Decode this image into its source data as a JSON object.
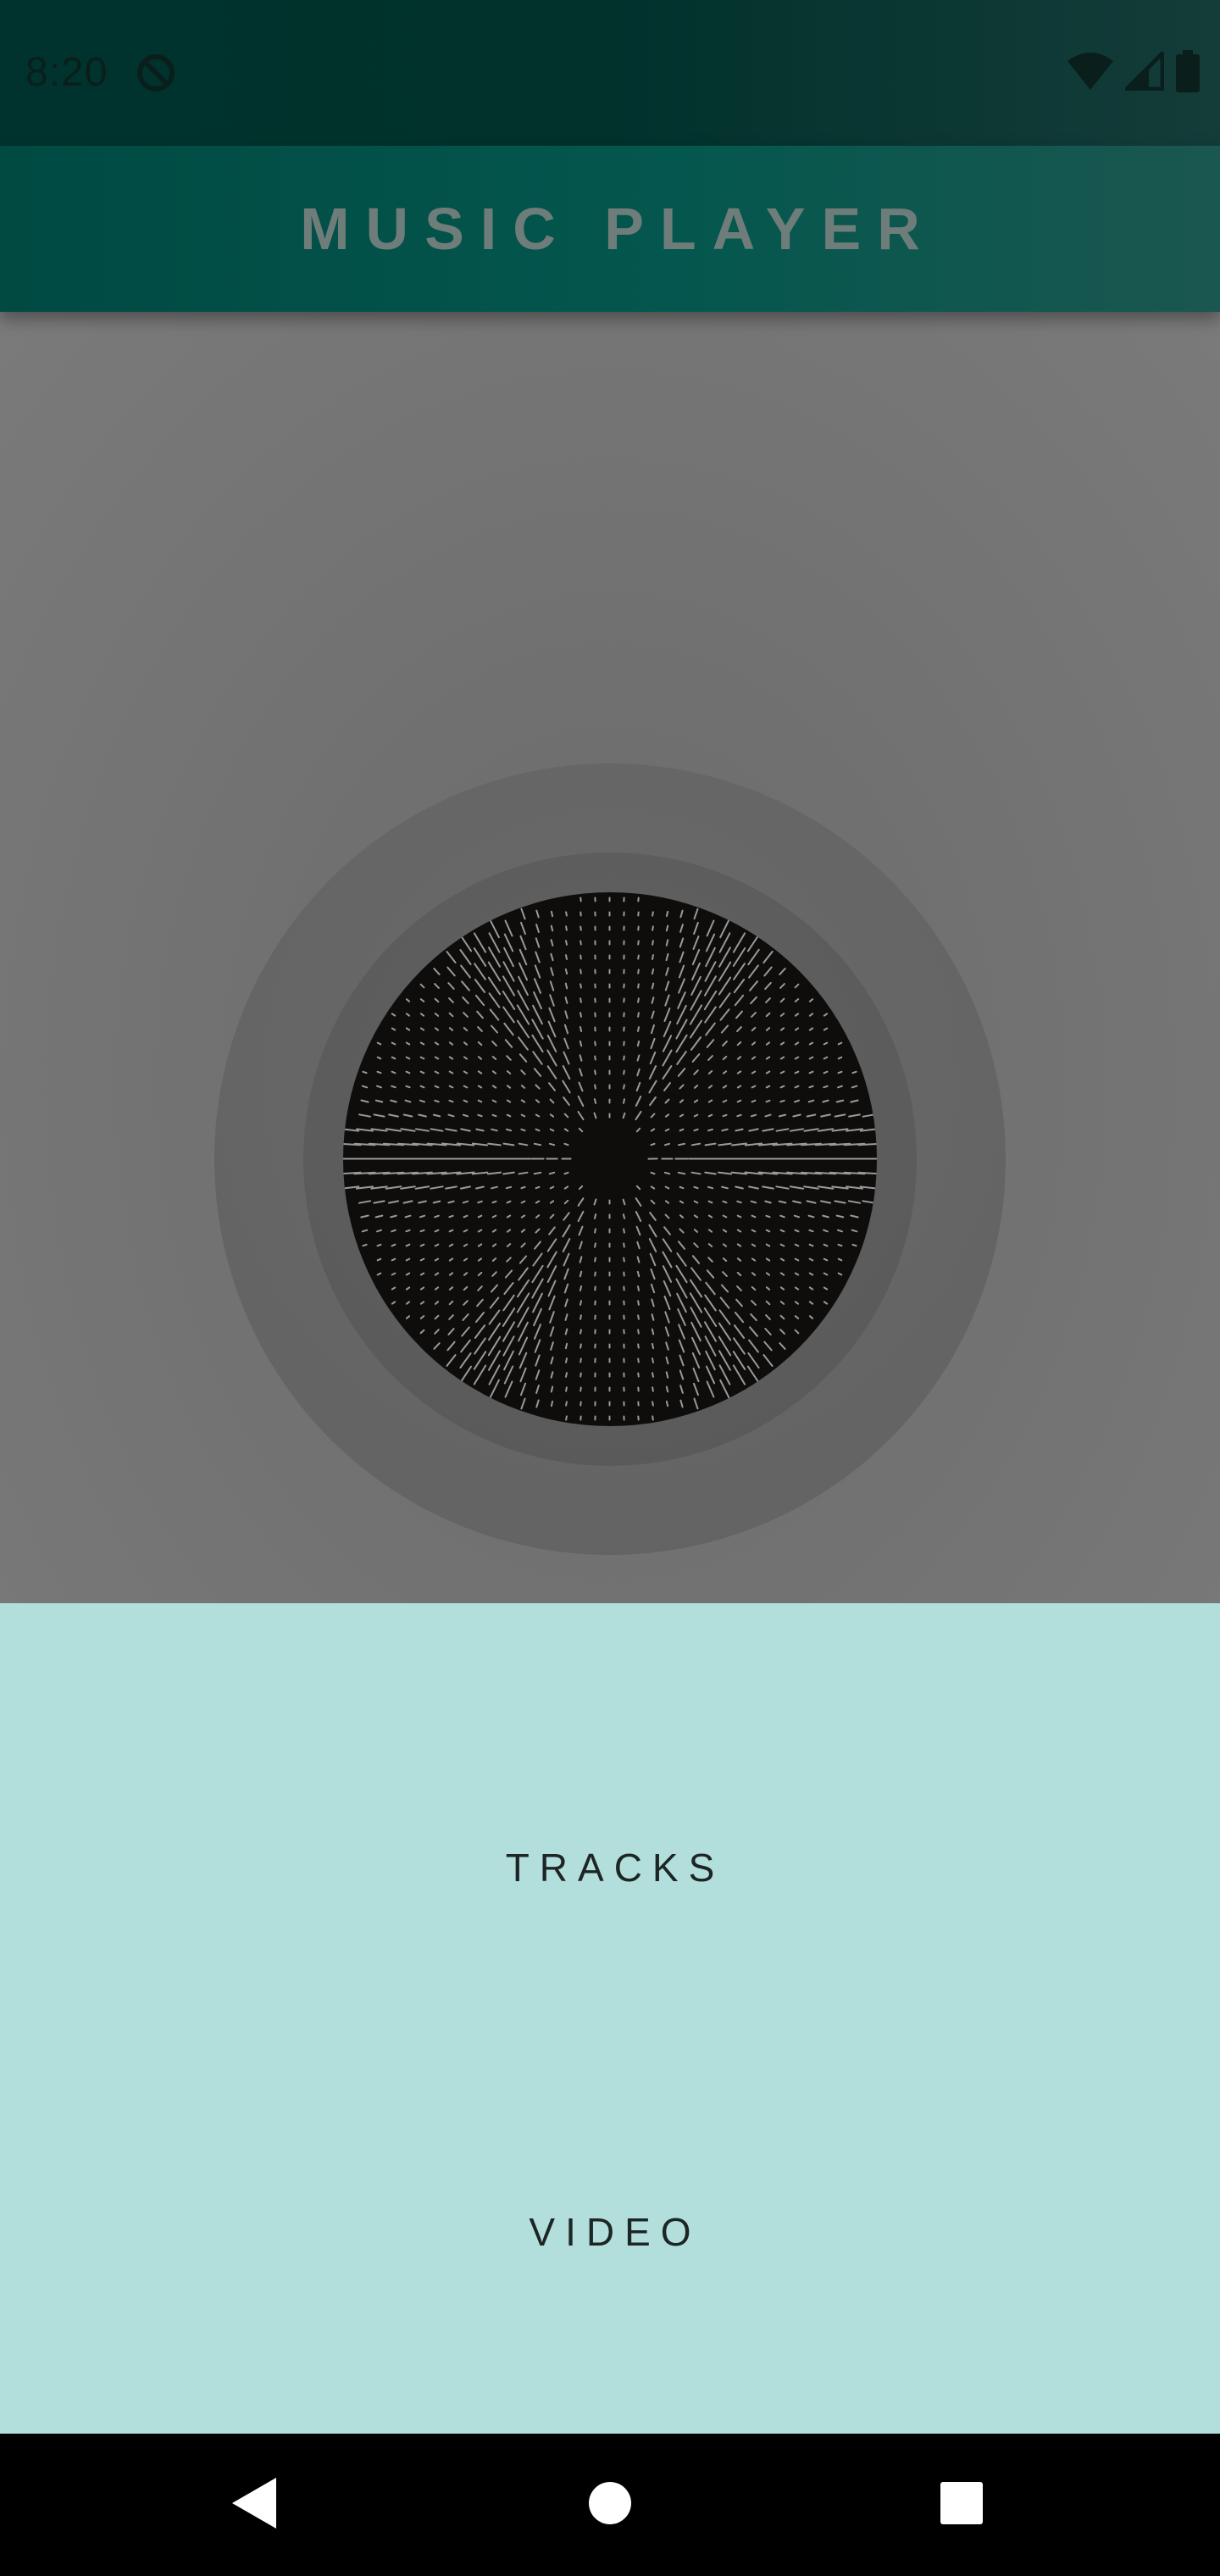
{
  "status_bar": {
    "time": "8:20",
    "icons": [
      "sync-disabled-icon",
      "wifi-icon",
      "cell-signal-icon",
      "battery-icon"
    ]
  },
  "app_bar": {
    "title": "MUSIC PLAYER"
  },
  "visualizer": {
    "icon": "audio-visualizer-disc"
  },
  "menu": {
    "items": [
      {
        "label": "TRACKS"
      },
      {
        "label": "VIDEO"
      }
    ]
  },
  "nav_bar": {
    "icons": [
      "back-icon",
      "home-icon",
      "recents-icon"
    ]
  },
  "colors": {
    "status_bar": "#01322c",
    "app_bar": "#04574e",
    "visualizer_bg": "#737373",
    "disc": "#0f0d0c",
    "menu_bg": "#b2dfdc",
    "menu_text": "#1d2624"
  }
}
